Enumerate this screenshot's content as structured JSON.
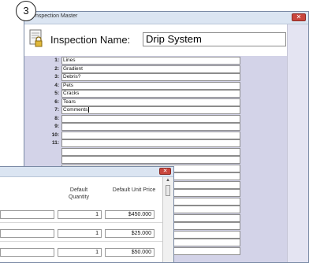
{
  "badge": "3",
  "window": {
    "title": "nspection Master",
    "inspection_label": "Inspection Name:",
    "inspection_value": "Drip System"
  },
  "lines": [
    {
      "num": "1:",
      "value": "Lines"
    },
    {
      "num": "2:",
      "value": "Gradient"
    },
    {
      "num": "3:",
      "value": "Debris?"
    },
    {
      "num": "4:",
      "value": "Pets"
    },
    {
      "num": "5:",
      "value": "Cracks"
    },
    {
      "num": "6:",
      "value": "Tears"
    },
    {
      "num": "7:",
      "value": "Comments"
    },
    {
      "num": "8:",
      "value": ""
    },
    {
      "num": "9:",
      "value": ""
    },
    {
      "num": "10:",
      "value": ""
    },
    {
      "num": "11:",
      "value": ""
    }
  ],
  "popup": {
    "col_quantity": "Default Quantity",
    "col_price": "Default Unit Price",
    "rows": [
      {
        "quantity": "1",
        "price": "$450.000"
      },
      {
        "quantity": "1",
        "price": "$25.000"
      },
      {
        "quantity": "1",
        "price": "$50.000"
      }
    ]
  }
}
